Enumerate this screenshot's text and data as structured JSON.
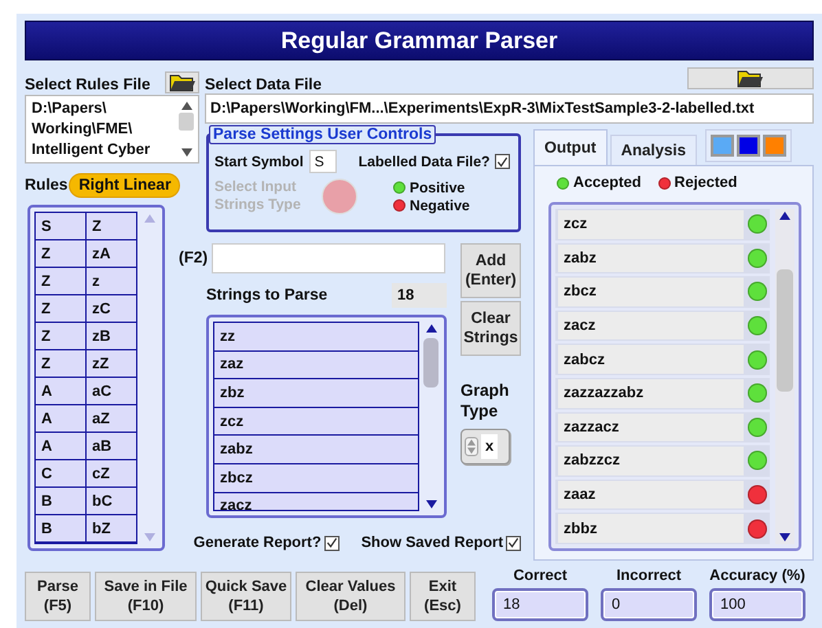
{
  "window": {
    "title": "Regular Grammar Parser"
  },
  "rules_file": {
    "label": "Select Rules File",
    "lines": [
      "D:\\Papers\\",
      "Working\\FME\\",
      "Intelligent Cyber"
    ]
  },
  "data_file": {
    "label": "Select Data File",
    "value": "D:\\Papers\\Working\\FM...\\Experiments\\ExpR-3\\MixTestSample3-2-labelled.txt"
  },
  "rules": {
    "label": "Rules",
    "badge": "Right Linear",
    "rows": [
      [
        "S",
        "Z"
      ],
      [
        "Z",
        "zA"
      ],
      [
        "Z",
        "z"
      ],
      [
        "Z",
        "zC"
      ],
      [
        "Z",
        "zB"
      ],
      [
        "Z",
        "zZ"
      ],
      [
        "A",
        "aC"
      ],
      [
        "A",
        "aZ"
      ],
      [
        "A",
        "aB"
      ],
      [
        "C",
        "cZ"
      ],
      [
        "B",
        "bC"
      ],
      [
        "B",
        "bZ"
      ]
    ]
  },
  "parse_settings": {
    "title": "Parse Settings User Controls",
    "start_symbol_label": "Start Symbol",
    "start_symbol": "S",
    "labelled_label": "Labelled Data File?",
    "labelled": true,
    "input_type_label": "Select Input Strings Type",
    "input_type_disabled": true,
    "legend": [
      {
        "label": "Positive",
        "color": "#5ee03c"
      },
      {
        "label": "Negative",
        "color": "#f0303c"
      }
    ]
  },
  "entry": {
    "label": "(F2)"
  },
  "side_buttons": [
    {
      "label": "Add\n(Enter)"
    },
    {
      "label": "Clear\nStrings"
    }
  ],
  "strings": {
    "label": "Strings to Parse",
    "count": "18",
    "items": [
      "zz",
      "zaz",
      "zbz",
      "zcz",
      "zabz",
      "zbcz",
      "zacz"
    ]
  },
  "graph_type": {
    "label": "Graph\nType",
    "value": "x"
  },
  "options": [
    {
      "label": "Generate Report?",
      "checked": true
    },
    {
      "label": "Show Saved Report",
      "checked": true
    }
  ],
  "tabs": [
    {
      "label": "Output",
      "selected": true
    },
    {
      "label": "Analysis",
      "selected": false
    }
  ],
  "swatches": [
    {
      "color": "#5aaaf5"
    },
    {
      "color": "#0000e6"
    },
    {
      "color": "#ff8000"
    }
  ],
  "output": {
    "legend": [
      {
        "label": "Accepted",
        "color": "#5ee03c"
      },
      {
        "label": "Rejected",
        "color": "#f0303c"
      }
    ],
    "items": [
      {
        "text": "zcz",
        "accepted": true
      },
      {
        "text": "zabz",
        "accepted": true
      },
      {
        "text": "zbcz",
        "accepted": true
      },
      {
        "text": "zacz",
        "accepted": true
      },
      {
        "text": "zabcz",
        "accepted": true
      },
      {
        "text": "zazzazzabz",
        "accepted": true
      },
      {
        "text": "zazzacz",
        "accepted": true
      },
      {
        "text": "zabzzcz",
        "accepted": true
      },
      {
        "text": "zaaz",
        "accepted": false
      },
      {
        "text": "zbbz",
        "accepted": false
      }
    ]
  },
  "footer_buttons": [
    {
      "label": "Parse",
      "key": "(F5)"
    },
    {
      "label": "Save in File",
      "key": "(F10)"
    },
    {
      "label": "Quick Save",
      "key": "(F11)"
    },
    {
      "label": "Clear Values",
      "key": "(Del)"
    },
    {
      "label": "Exit",
      "key": "(Esc)"
    }
  ],
  "stats": [
    {
      "label": "Correct",
      "value": "18"
    },
    {
      "label": "Incorrect",
      "value": "0"
    },
    {
      "label": "Accuracy (%)",
      "value": "100"
    }
  ]
}
